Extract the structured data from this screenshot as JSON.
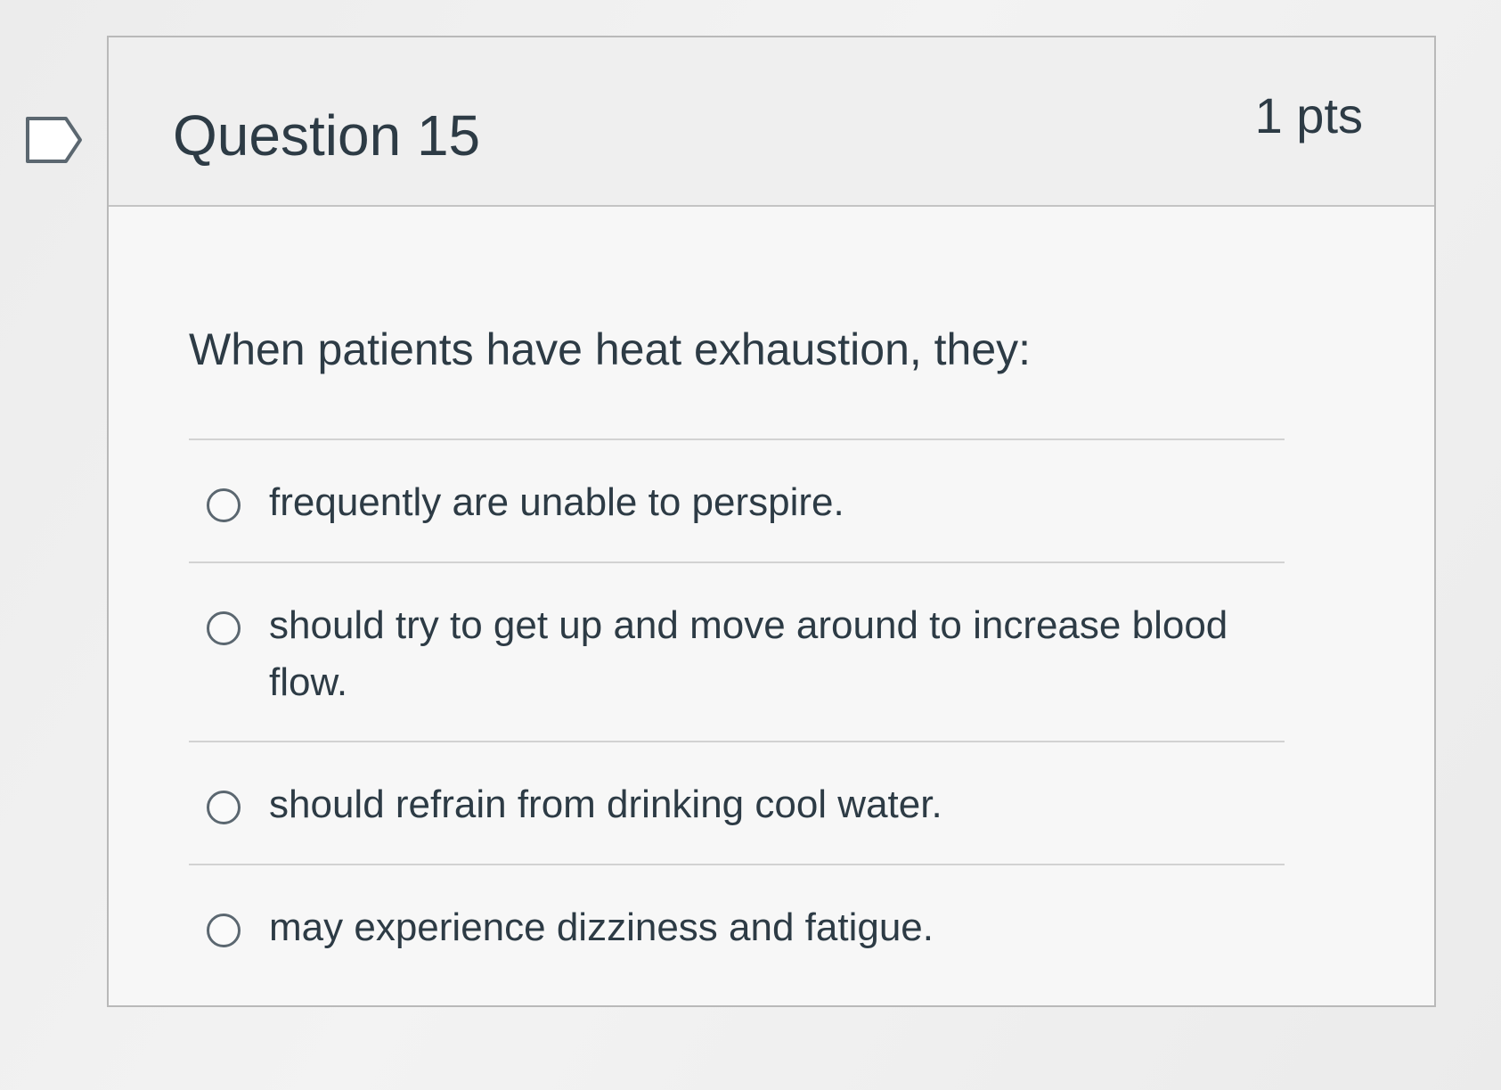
{
  "question": {
    "title": "Question 15",
    "points": "1 pts",
    "text": "When patients have heat exhaustion, they:"
  },
  "answers": [
    {
      "label": "frequently are unable to perspire.",
      "selected": false
    },
    {
      "label": "should try to get up and move around to increase blood flow.",
      "selected": false
    },
    {
      "label": "should refrain from drinking cool water.",
      "selected": false
    },
    {
      "label": "may experience dizziness and fatigue.",
      "selected": false
    }
  ],
  "icons": {
    "flag": "flag-question-icon",
    "radio": "radio-unselected-icon"
  },
  "colors": {
    "text": "#2d3b45",
    "border": "#b9b9b9",
    "header_bg": "#efefef"
  }
}
